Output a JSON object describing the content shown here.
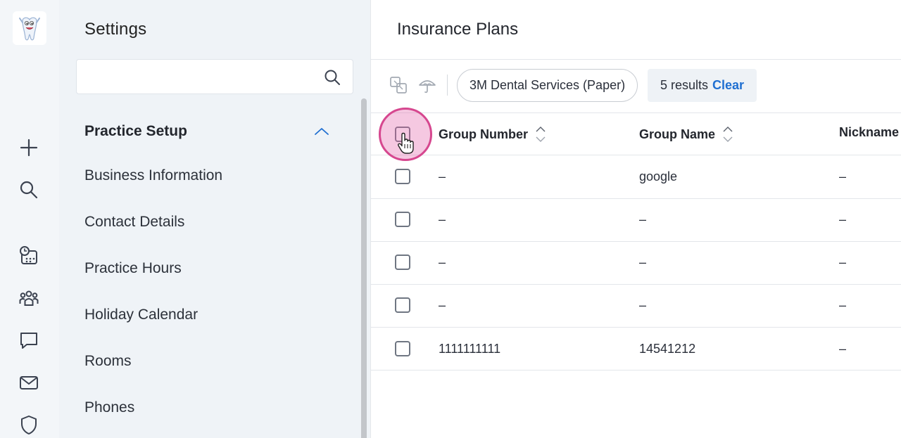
{
  "rail": {
    "logo": "tooth-mascot-logo",
    "buttons": [
      "add-icon",
      "search-icon",
      "calendar-clock-icon",
      "people-icon",
      "chat-icon",
      "mail-icon",
      "shield-icon"
    ]
  },
  "settings": {
    "title": "Settings",
    "search": {
      "value": "",
      "placeholder": ""
    },
    "section": "Practice Setup",
    "items": [
      "Business Information",
      "Contact Details",
      "Practice Hours",
      "Holiday Calendar",
      "Rooms",
      "Phones"
    ]
  },
  "main": {
    "title": "Insurance Plans",
    "filter_chip": "3M Dental Services (Paper)",
    "results_text": "5 results",
    "clear_label": "Clear",
    "columns": [
      "Group Number",
      "Group Name",
      "Nickname"
    ],
    "rows": [
      {
        "group_number": "–",
        "group_name": "google",
        "nickname": "–"
      },
      {
        "group_number": "–",
        "group_name": "–",
        "nickname": "–"
      },
      {
        "group_number": "–",
        "group_name": "–",
        "nickname": "–"
      },
      {
        "group_number": "–",
        "group_name": "–",
        "nickname": "–"
      },
      {
        "group_number": "1111111111",
        "group_name": "14541212",
        "nickname": "–"
      }
    ]
  },
  "colors": {
    "accent": "#1f6fd1",
    "highlight": "#d6478f",
    "rail_bg": "#f3f6f9",
    "settings_bg": "#eff3f7"
  }
}
